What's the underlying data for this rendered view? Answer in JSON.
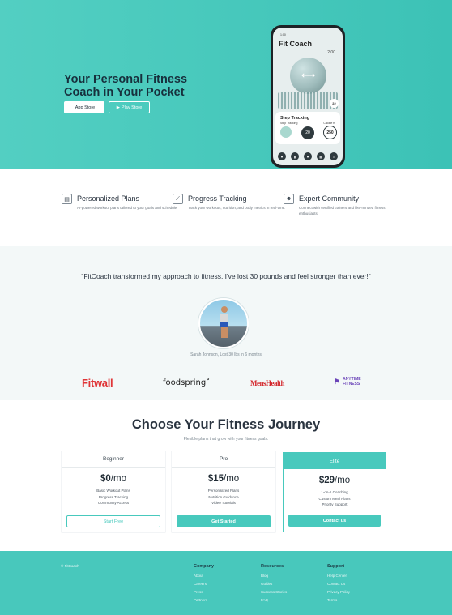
{
  "hero": {
    "title": "Your Personal Fitness Coach in Your Pocket",
    "app_store_label": "App Store",
    "play_store_label": "Play Store",
    "apple_icon": "",
    "play_icon": "▶"
  },
  "phone": {
    "status_time": "1:00",
    "app_title": "Fit Coach",
    "clock": "2:00",
    "badge": "22",
    "step_title": "Step Tracking",
    "step_sub": "Step Tracking",
    "calorie_label": "Calorie ts",
    "ring_value": "20",
    "calorie_value": "250",
    "orb_icon": "dumbbell-icon"
  },
  "features": [
    {
      "title": "Personalized Plans",
      "desc": "AI-powered workout plans tailored to your goals and schedule.",
      "icon": "calendar-icon"
    },
    {
      "title": "Progress Tracking",
      "desc": "Track your workouts, nutrition, and body metrics in real-time.",
      "icon": "chart-line-icon"
    },
    {
      "title": "Expert Community",
      "desc": "Connect with certified trainers and like-minded fitness enthusiasts.",
      "icon": "users-icon"
    }
  ],
  "testimonial": {
    "quote": "\"FitCoach transformed my approach to fitness. I've lost 30 pounds and feel stronger than ever!\"",
    "caption": "Sarah Johnson, Lost 30 lbs in 6 months"
  },
  "partners": {
    "fitwall": "Fitwall",
    "foodspring": "foodspring˚",
    "menshealth": "MensHealth",
    "anytime_line1": "ANYTIME",
    "anytime_line2": "FITNESS"
  },
  "pricing": {
    "title": "Choose Your Fitness Journey",
    "subtitle": "Flexible plans that grow with your fitness goals.",
    "plans": [
      {
        "name": "Beginner",
        "price": "$0",
        "period": "/mo",
        "features": [
          "Basic Workout Plans",
          "Progress Tracking",
          "Community Access"
        ],
        "cta": "Start Free"
      },
      {
        "name": "Pro",
        "price": "$15",
        "period": "/mo",
        "features": [
          "Personalized Plans",
          "Nutrition Guidance",
          "Video Tutorials"
        ],
        "cta": "Get Started"
      },
      {
        "name": "Elite",
        "price": "$29",
        "period": "/mo",
        "features": [
          "1-on-1 Coaching",
          "Custom Meal Plans",
          "Priority Support"
        ],
        "cta": "Contact us"
      }
    ]
  },
  "footer": {
    "copyright": "© FitCoach",
    "columns": [
      {
        "title": "Company",
        "links": [
          "About",
          "Careers",
          "Press",
          "Partners"
        ]
      },
      {
        "title": "Resources",
        "links": [
          "Blog",
          "Guides",
          "Success Stories",
          "FAQ"
        ]
      },
      {
        "title": "Support",
        "links": [
          "Help Center",
          "Contact Us",
          "Privacy Policy",
          "Terms"
        ]
      }
    ]
  },
  "colors": {
    "teal": "#48c9bd",
    "hero_gradient_start": "#53cfc2",
    "dark_text": "#17303d",
    "brand_red": "#e03537",
    "anytime_purple": "#6a44b8"
  }
}
